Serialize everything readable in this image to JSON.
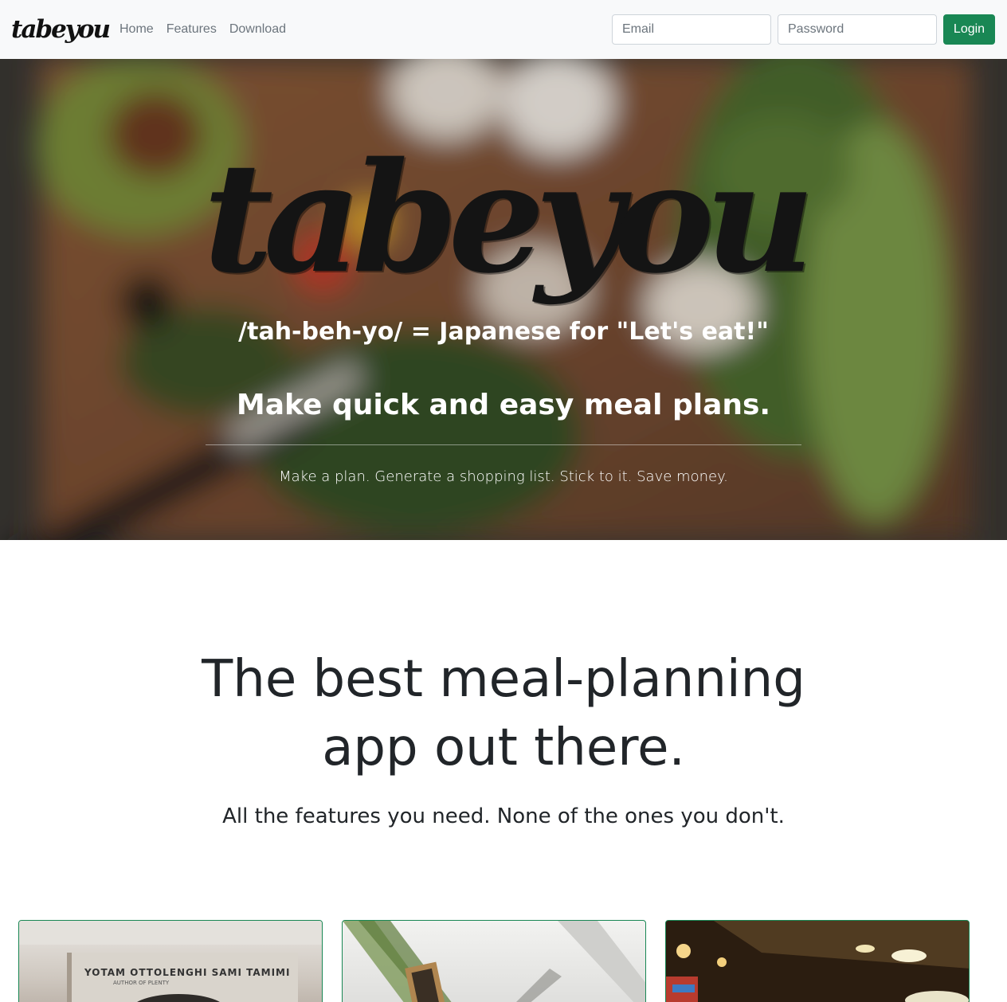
{
  "navbar": {
    "brand": "tabeyou",
    "links": [
      "Home",
      "Features",
      "Download"
    ],
    "email_placeholder": "Email",
    "password_placeholder": "Password",
    "login_label": "Login"
  },
  "hero": {
    "logo_text": "tabeyou",
    "pronunciation": "/tah-beh-yo/ = Japanese for \"Let's eat!\"",
    "tagline": "Make quick and easy meal plans.",
    "subtext": "Make a plan. Generate a shopping list. Stick to it. Save money."
  },
  "features": {
    "headline_line1": "The best meal-planning",
    "headline_line2": "app out there.",
    "subheadline": "All the features you need. None of the ones you don't.",
    "card1_book_title": "YOTAM OTTOLENGHI  SAMI TAMIMI",
    "card1_book_sub": "AUTHOR OF PLENTY"
  },
  "colors": {
    "accent": "#198754",
    "navbar_bg": "#f8f9fa"
  }
}
